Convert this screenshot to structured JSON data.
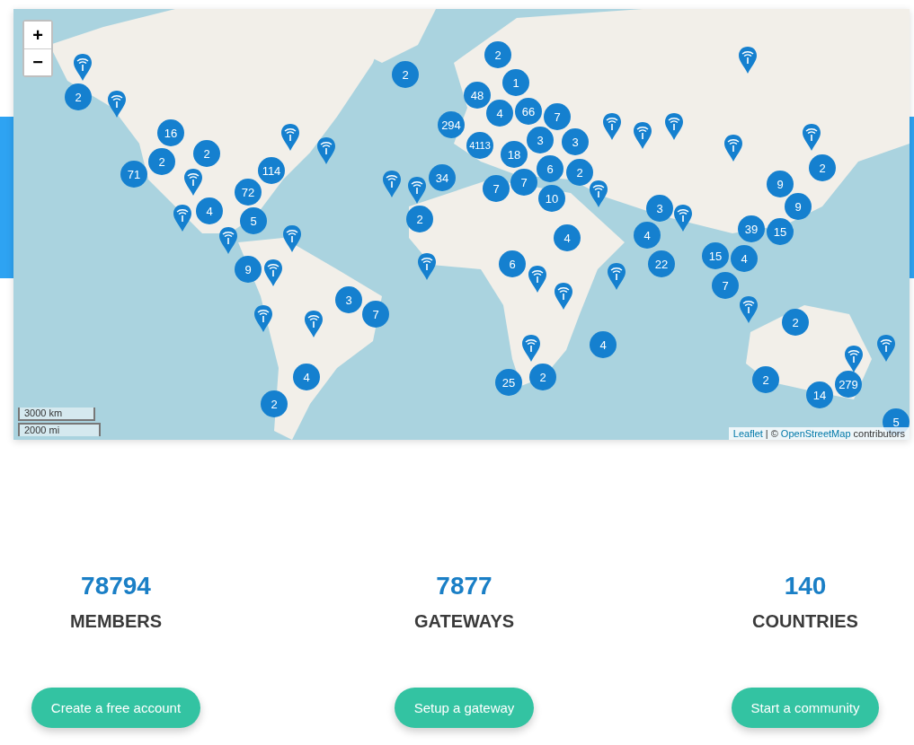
{
  "map": {
    "zoom_in": "+",
    "zoom_out": "−",
    "clusters": [
      {
        "label": "2"
      },
      {
        "label": "16"
      },
      {
        "label": "2"
      },
      {
        "label": "71"
      },
      {
        "label": "2"
      },
      {
        "label": "114"
      },
      {
        "label": "72"
      },
      {
        "label": "4"
      },
      {
        "label": "5"
      },
      {
        "label": "9"
      },
      {
        "label": "2"
      },
      {
        "label": "2"
      },
      {
        "label": "48"
      },
      {
        "label": "1"
      },
      {
        "label": "4"
      },
      {
        "label": "66"
      },
      {
        "label": "294"
      },
      {
        "label": "4113"
      },
      {
        "label": "7"
      },
      {
        "label": "3"
      },
      {
        "label": "3"
      },
      {
        "label": "18"
      },
      {
        "label": "7"
      },
      {
        "label": "7"
      },
      {
        "label": "6"
      },
      {
        "label": "2"
      },
      {
        "label": "10"
      },
      {
        "label": "34"
      },
      {
        "label": "2"
      },
      {
        "label": "4"
      },
      {
        "label": "6"
      },
      {
        "label": "3"
      },
      {
        "label": "7"
      },
      {
        "label": "4"
      },
      {
        "label": "2"
      },
      {
        "label": "25"
      },
      {
        "label": "2"
      },
      {
        "label": "4"
      },
      {
        "label": "3"
      },
      {
        "label": "4"
      },
      {
        "label": "22"
      },
      {
        "label": "9"
      },
      {
        "label": "9"
      },
      {
        "label": "2"
      },
      {
        "label": "39"
      },
      {
        "label": "15"
      },
      {
        "label": "15"
      },
      {
        "label": "4"
      },
      {
        "label": "7"
      },
      {
        "label": "2"
      },
      {
        "label": "2"
      },
      {
        "label": "14"
      },
      {
        "label": "279"
      },
      {
        "label": "5"
      }
    ],
    "scale": [
      "3000 km",
      "2000 mi"
    ],
    "attribution": {
      "links": [
        "Leaflet",
        "OpenStreetMap"
      ],
      "separator": "| ©",
      "suffix": "contributors"
    }
  },
  "stats": [
    {
      "value": "78794",
      "label": "MEMBERS",
      "button": "Create a free account"
    },
    {
      "value": "7877",
      "label": "GATEWAYS",
      "button": "Setup a gateway"
    },
    {
      "value": "140",
      "label": "COUNTRIES",
      "button": "Start a community"
    }
  ]
}
